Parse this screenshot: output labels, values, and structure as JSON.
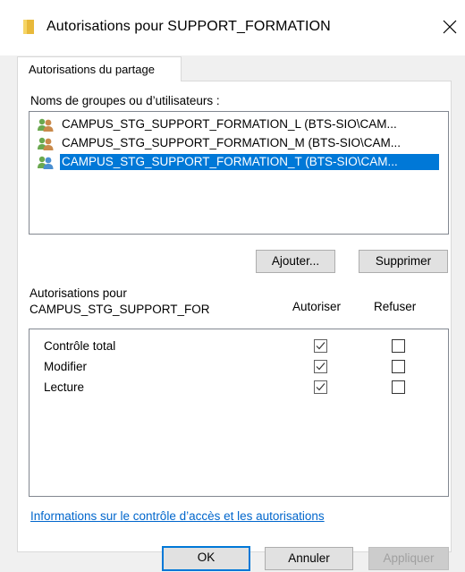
{
  "window": {
    "title": "Autorisations pour SUPPORT_FORMATION",
    "icon": "folder-icon"
  },
  "tabs": [
    {
      "label": "Autorisations du partage",
      "active": true
    }
  ],
  "groups": {
    "label": "Noms de groupes ou d’utilisateurs :",
    "items": [
      {
        "name": "CAMPUS_STG_SUPPORT_FORMATION_L (BTS-SIO\\CAM...",
        "icon": "user-group-icon",
        "selected": false
      },
      {
        "name": "CAMPUS_STG_SUPPORT_FORMATION_M (BTS-SIO\\CAM...",
        "icon": "user-group-icon",
        "selected": false
      },
      {
        "name": "CAMPUS_STG_SUPPORT_FORMATION_T (BTS-SIO\\CAM...",
        "icon": "user-group-icon",
        "selected": true
      }
    ],
    "add_label": "Ajouter...",
    "remove_label": "Supprimer"
  },
  "permissions": {
    "header_line1": "Autorisations pour",
    "header_line2": "CAMPUS_STG_SUPPORT_FOR",
    "allow_header": "Autoriser",
    "deny_header": "Refuser",
    "rows": [
      {
        "name": "Contrôle total",
        "allow": true,
        "deny": false
      },
      {
        "name": "Modifier",
        "allow": true,
        "deny": false
      },
      {
        "name": "Lecture",
        "allow": true,
        "deny": false
      }
    ]
  },
  "info_link": "Informations sur le contrôle d’accès et les autorisations",
  "buttons": {
    "ok": "OK",
    "cancel": "Annuler",
    "apply": "Appliquer"
  },
  "colors": {
    "selection": "#0078d7",
    "link": "#0066cc",
    "folder": "#f4c542"
  }
}
